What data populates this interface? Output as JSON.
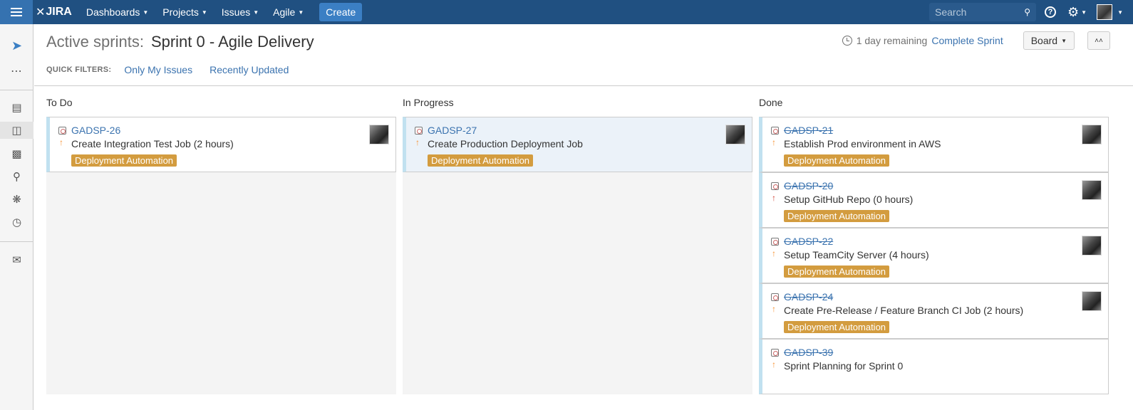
{
  "topbar": {
    "logo_text": "JIRA",
    "nav": [
      {
        "label": "Dashboards"
      },
      {
        "label": "Projects"
      },
      {
        "label": "Issues"
      },
      {
        "label": "Agile"
      }
    ],
    "create_label": "Create",
    "search_placeholder": "Search",
    "help_glyph": "?"
  },
  "sidebar": {
    "icons": [
      "project-rocket-icon",
      "more-icon",
      "backlog-icon",
      "active-sprints-icon",
      "reports-icon",
      "issues-search-icon",
      "bug-icon",
      "releases-icon",
      "feedback-megaphone-icon"
    ]
  },
  "header": {
    "title_prefix": "Active sprints:",
    "sprint_name": "Sprint 0 - Agile Delivery",
    "remaining": "1 day remaining",
    "complete_sprint": "Complete Sprint",
    "board_label": "Board",
    "quick_filters_label": "QUICK FILTERS:",
    "quick_filters": [
      "Only My Issues",
      "Recently Updated"
    ]
  },
  "columns": [
    {
      "name": "To Do",
      "cards": [
        {
          "key": "GADSP-26",
          "summary": "Create Integration Test Job (2 hours)",
          "epic": "Deployment Automation",
          "priority": "major",
          "done": false
        }
      ]
    },
    {
      "name": "In Progress",
      "cards": [
        {
          "key": "GADSP-27",
          "summary": "Create Production Deployment Job",
          "epic": "Deployment Automation",
          "priority": "major",
          "done": false
        }
      ]
    },
    {
      "name": "Done",
      "cards": [
        {
          "key": "GADSP-21",
          "summary": "Establish Prod environment in AWS",
          "epic": "Deployment Automation",
          "priority": "major",
          "done": true
        },
        {
          "key": "GADSP-20",
          "summary": "Setup GitHub Repo (0 hours)",
          "epic": "Deployment Automation",
          "priority": "critical",
          "done": true
        },
        {
          "key": "GADSP-22",
          "summary": "Setup TeamCity Server (4 hours)",
          "epic": "Deployment Automation",
          "priority": "major",
          "done": true
        },
        {
          "key": "GADSP-24",
          "summary": "Create Pre-Release / Feature Branch CI Job (2 hours)",
          "epic": "Deployment Automation",
          "priority": "major",
          "done": true
        },
        {
          "key": "GADSP-39",
          "summary": "Sprint Planning for Sprint 0",
          "epic": "",
          "priority": "major",
          "done": true
        }
      ]
    }
  ],
  "colors": {
    "topbar": "#205081",
    "accent_link": "#3b73af",
    "epic_label": "#d39c3f",
    "card_border_left": "#c1e1f0",
    "priority_major": "#f79232",
    "priority_critical": "#d04437"
  }
}
